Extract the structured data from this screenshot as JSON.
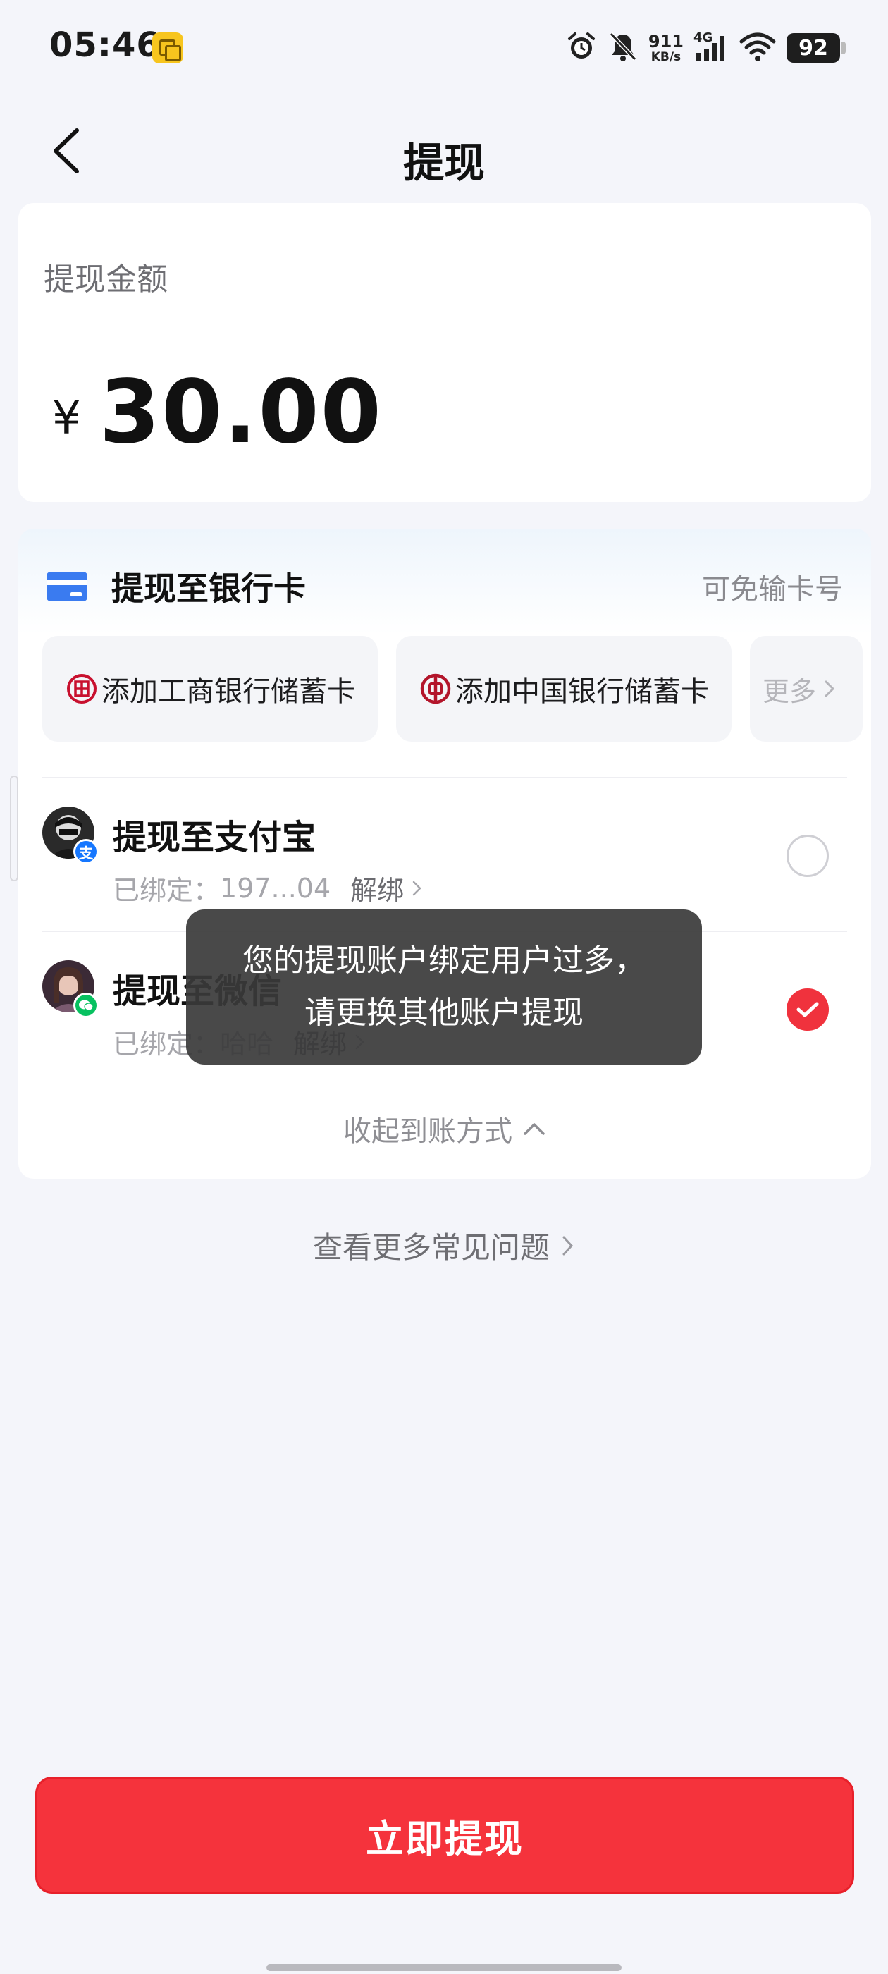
{
  "status_bar": {
    "time": "05:46",
    "network_speed_value": "911",
    "network_speed_unit": "KB/s",
    "network_type": "4G",
    "battery": "92",
    "icons": [
      "notification-app-icon",
      "alarm-icon",
      "mute-bell-icon",
      "signal-icon",
      "wifi-icon",
      "battery-icon"
    ]
  },
  "nav": {
    "title": "提现",
    "back_icon": "chevron-left-icon"
  },
  "amount": {
    "label": "提现金额",
    "currency": "¥",
    "value": "30.00"
  },
  "bank": {
    "title": "提现至银行卡",
    "hint": "可免输卡号",
    "chips": [
      {
        "label": "添加工商银行储蓄卡",
        "icon": "icbc-logo-icon",
        "color": "#c8102e"
      },
      {
        "label": "添加中国银行储蓄卡",
        "icon": "boc-logo-icon",
        "color": "#b3152b"
      },
      {
        "label": "更多"
      }
    ]
  },
  "methods": [
    {
      "title": "提现至支付宝",
      "bound_label": "已绑定：",
      "account": "197...04",
      "unbind": "解绑",
      "selected": false
    },
    {
      "title": "提现至微信",
      "bound_label": "已绑定：",
      "account": "哈哈",
      "unbind": "解绑",
      "selected": true
    }
  ],
  "collapse_label": "收起到账方式",
  "faq_label": "查看更多常见问题",
  "toast": {
    "message": "您的提现账户绑定用户过多，请更换其他账户提现"
  },
  "submit_label": "立即提现",
  "colors": {
    "accent_red": "#f5333c",
    "alipay_blue": "#1677ff",
    "wechat_green": "#07c160",
    "card_blue": "#3a7bf0"
  }
}
